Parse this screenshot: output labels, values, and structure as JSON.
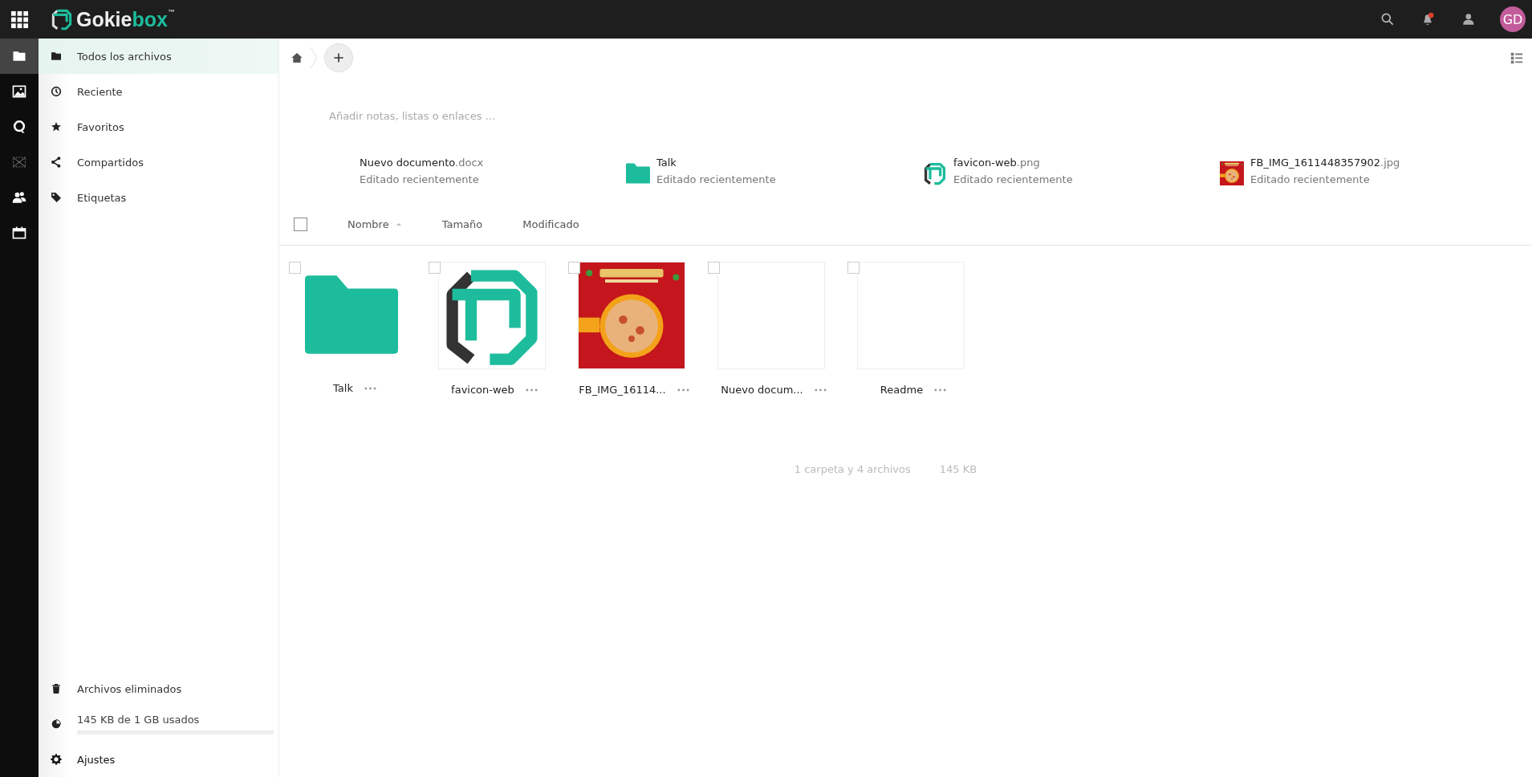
{
  "header": {
    "brand": {
      "first": "Gokie",
      "second": "box",
      "mark": "™"
    },
    "notifications": {
      "unread": true
    },
    "avatar": "GD"
  },
  "rail": [
    {
      "kind": "files",
      "selected": true
    },
    {
      "kind": "photos",
      "selected": false
    },
    {
      "kind": "talk",
      "selected": false
    },
    {
      "kind": "deck",
      "selected": false
    },
    {
      "kind": "contacts",
      "selected": false
    },
    {
      "kind": "calendar",
      "selected": false
    }
  ],
  "sidebar": {
    "items": [
      {
        "kind": "folder",
        "label": "Todos los archivos",
        "selected": true
      },
      {
        "kind": "clock",
        "label": "Reciente",
        "selected": false
      },
      {
        "kind": "star",
        "label": "Favoritos",
        "selected": false
      },
      {
        "kind": "share",
        "label": "Compartidos",
        "selected": false
      },
      {
        "kind": "tag",
        "label": "Etiquetas",
        "selected": false
      }
    ],
    "trash": "Archivos eliminados",
    "quota": {
      "label": "145 KB de 1 GB usados",
      "level": 0.0001
    },
    "settings": "Ajustes"
  },
  "notes": {
    "placeholder": "Añadir notas, listas o enlaces ..."
  },
  "recent": [
    {
      "kind": "none",
      "name": "Nuevo documento",
      "ext": ".docx",
      "status": "Editado recientemente"
    },
    {
      "kind": "folder",
      "name": "Talk",
      "status": "Editado recientemente"
    },
    {
      "kind": "logo",
      "name": "favicon-web",
      "ext": ".png",
      "status": "Editado recientemente"
    },
    {
      "kind": "picture",
      "name": "FB_IMG_1611448357902",
      "ext": ".jpg",
      "status": "Editado recientemente"
    }
  ],
  "table": {
    "checked": false,
    "columns": [
      "Nombre",
      "Tamaño",
      "Modificado"
    ]
  },
  "files": [
    {
      "kind": "folder",
      "name": "Talk",
      "checked": false
    },
    {
      "kind": "logo",
      "name": "favicon-web",
      "checked": false
    },
    {
      "kind": "picture",
      "name": "FB_IMG_16114...",
      "checked": false
    },
    {
      "kind": "blank",
      "name": "Nuevo docum...",
      "checked": false
    },
    {
      "kind": "blank",
      "name": "Readme",
      "checked": false
    }
  ],
  "summary": {
    "count": "1 carpeta y 4 archivos",
    "size": "145 KB"
  }
}
